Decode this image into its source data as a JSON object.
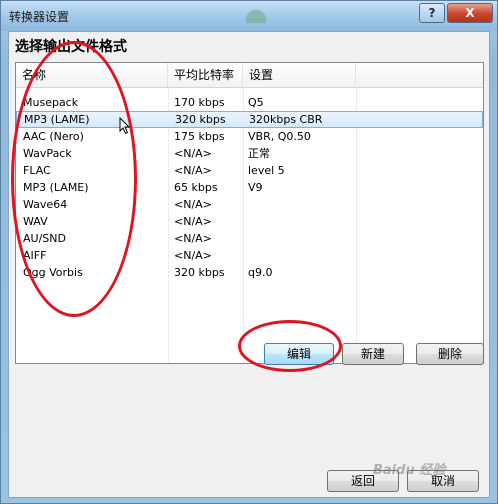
{
  "window": {
    "title": "转换器设置",
    "help_label": "?",
    "close_label": "X"
  },
  "dialog": {
    "heading": "选择输出文件格式"
  },
  "list": {
    "columns": [
      "名称",
      "平均比特率",
      "设置"
    ],
    "rows": [
      {
        "name": "Musepack",
        "bitrate": "170 kbps",
        "settings": "Q5"
      },
      {
        "name": "MP3 (LAME)",
        "bitrate": "320 kbps",
        "settings": "320kbps CBR"
      },
      {
        "name": "AAC (Nero)",
        "bitrate": "175 kbps",
        "settings": "VBR, Q0.50"
      },
      {
        "name": "WavPack",
        "bitrate": "<N/A>",
        "settings": "正常"
      },
      {
        "name": "FLAC",
        "bitrate": "<N/A>",
        "settings": "level 5"
      },
      {
        "name": "MP3 (LAME)",
        "bitrate": "65 kbps",
        "settings": "V9"
      },
      {
        "name": "Wave64",
        "bitrate": "<N/A>",
        "settings": ""
      },
      {
        "name": "WAV",
        "bitrate": "<N/A>",
        "settings": ""
      },
      {
        "name": "AU/SND",
        "bitrate": "<N/A>",
        "settings": ""
      },
      {
        "name": "AIFF",
        "bitrate": "<N/A>",
        "settings": ""
      },
      {
        "name": "Ogg Vorbis",
        "bitrate": "320 kbps",
        "settings": "q9.0"
      }
    ],
    "selected_row": 1
  },
  "actions": {
    "edit_label": "编辑",
    "new_label": "新建",
    "delete_label": "删除",
    "back_label": "返回",
    "cancel_label": "取消"
  },
  "watermark": "Baidu 经验",
  "colors": {
    "annotation_red": "#e0141f",
    "selection_border": "#84acdd"
  }
}
